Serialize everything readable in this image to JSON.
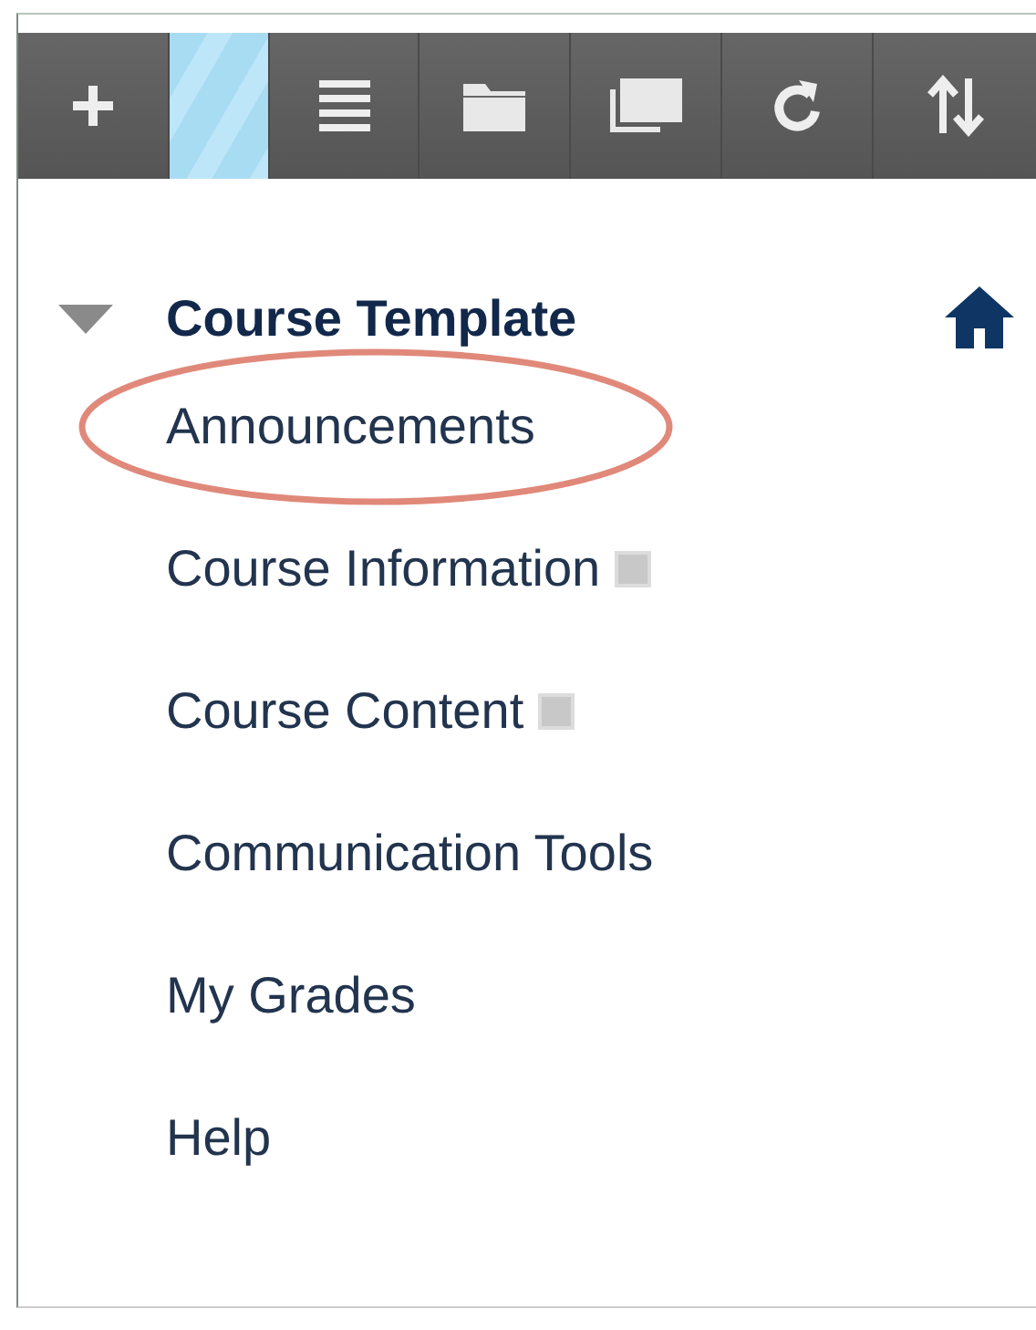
{
  "toolbar": {
    "buttons": [
      {
        "kind": "add",
        "selected": false
      },
      {
        "kind": "blank",
        "selected": true
      },
      {
        "kind": "list",
        "selected": false
      },
      {
        "kind": "folder",
        "selected": false
      },
      {
        "kind": "windows",
        "selected": false
      },
      {
        "kind": "refresh",
        "selected": false
      },
      {
        "kind": "sort",
        "selected": false
      }
    ]
  },
  "menu": {
    "title": "Course Template",
    "expanded": true,
    "items": [
      {
        "label": "Announcements",
        "badge": false,
        "circled": true
      },
      {
        "label": "Course Information",
        "badge": true,
        "circled": false
      },
      {
        "label": "Course Content",
        "badge": true,
        "circled": false
      },
      {
        "label": "Communication Tools",
        "badge": false,
        "circled": false
      },
      {
        "label": "My Grades",
        "badge": false,
        "circled": false
      },
      {
        "label": "Help",
        "badge": false,
        "circled": false
      }
    ]
  }
}
